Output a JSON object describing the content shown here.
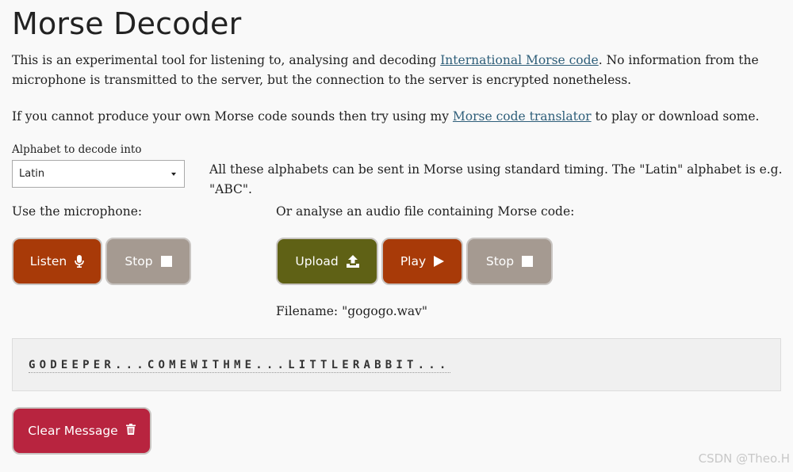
{
  "page": {
    "title": "Morse Decoder"
  },
  "intro": {
    "text_before": "This is an experimental tool for listening to, analysing and decoding ",
    "link_text": "International Morse code",
    "text_after": ". No information from the microphone is transmitted to the server, but the connection to the server is encrypted nonetheless."
  },
  "translator_note": {
    "text_before": "If you cannot produce your own Morse code sounds then try using my ",
    "link_text": "Morse code translator",
    "text_after": " to play or download some."
  },
  "alphabet": {
    "label": "Alphabet to decode into",
    "selected": "Latin",
    "hint": "All these alphabets can be sent in Morse using standard timing. The \"Latin\" alphabet is e.g. \"ABC\"."
  },
  "microphone": {
    "label": "Use the microphone:",
    "listen_label": "Listen",
    "stop_label": "Stop"
  },
  "audio_file": {
    "label": "Or analyse an audio file containing Morse code:",
    "upload_label": "Upload",
    "play_label": "Play",
    "stop_label": "Stop",
    "filename_text": "Filename: \"gogogo.wav\""
  },
  "output": {
    "decoded_text": "GODEEPER...COMEWITHME...LITTLERABBIT..."
  },
  "clear": {
    "label": "Clear Message"
  },
  "watermark": {
    "text": "CSDN @Theo.H"
  },
  "icons": {
    "listen": "microphone-icon",
    "stop": "stop-square-icon",
    "upload": "upload-icon",
    "play": "play-icon",
    "clear": "trash-icon"
  },
  "colors": {
    "listen_button": "#a83a08",
    "stop_button": "#a59a91",
    "upload_button": "#5f6115",
    "play_button": "#a83a08",
    "clear_button": "#b8243f",
    "link": "#2f5f7a"
  }
}
